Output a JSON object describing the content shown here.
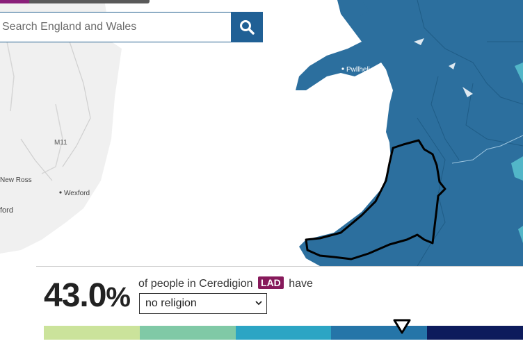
{
  "search": {
    "placeholder": "Search England and Wales",
    "button_icon": "search-icon"
  },
  "map": {
    "place_labels": [
      "Pwllheli",
      "New Ross",
      "Wexford",
      "ford"
    ],
    "road_labels": [
      "M11"
    ],
    "highlighted_area": "Ceredigion"
  },
  "panel": {
    "value_number": "43.0",
    "value_unit": "%",
    "sentence_pre": "of people in Ceredigion",
    "badge": "LAD",
    "sentence_post": "have",
    "selected_option": "no religion"
  },
  "legend": {
    "colors": [
      "#cbe39b",
      "#80c9a6",
      "#2ca5c4",
      "#2575a8",
      "#0d1b5c"
    ],
    "marker_value_percent": 43.0,
    "marker_icon": "triangle-down-icon"
  },
  "colors": {
    "accent": "#206095",
    "land": "#2c6f9e",
    "sea": "#ffffff",
    "badge": "#871a5b"
  }
}
